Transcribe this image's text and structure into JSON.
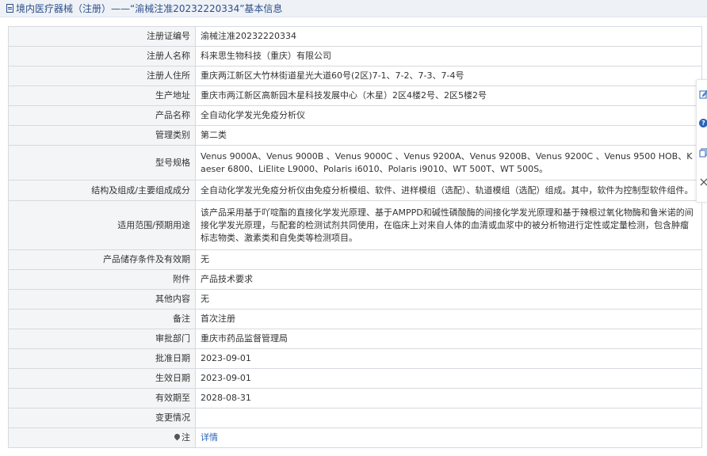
{
  "header": {
    "title": "境内医疗器械（注册）——“渝械注准20232220334”基本信息"
  },
  "rows": [
    {
      "label": "注册证编号",
      "value": "渝械注准20232220334"
    },
    {
      "label": "注册人名称",
      "value": "科来思生物科技（重庆）有限公司"
    },
    {
      "label": "注册人住所",
      "value": "重庆两江新区大竹林街道星光大道60号(2区)7-1、7-2、7-3、7-4号"
    },
    {
      "label": "生产地址",
      "value": "重庆市两江新区高新园木星科技发展中心（木星）2区4楼2号、2区5楼2号"
    },
    {
      "label": "产品名称",
      "value": "全自动化学发光免疫分析仪"
    },
    {
      "label": "管理类别",
      "value": "第二类"
    },
    {
      "label": "型号规格",
      "value": "Venus 9000A、Venus 9000B 、Venus 9000C 、Venus 9200A、Venus 9200B、Venus 9200C 、Venus 9500 HOB、Kaeser 6800、LiElite L9000、Polaris i6010、Polaris i9010、WT 500T、WT 500S。"
    },
    {
      "label": "结构及组成/主要组成成分",
      "value": "全自动化学发光免疫分析仪由免疫分析模组、软件、进样模组（选配）、轨道模组（选配）组成。其中，软件为控制型软件组件。"
    },
    {
      "label": "适用范围/预期用途",
      "value": "该产品采用基于吖啶酯的直接化学发光原理、基于AMPPD和碱性磷酸酶的间接化学发光原理和基于辣根过氧化物酶和鲁米诺的间接化学发光原理，与配套的检测试剂共同使用，在临床上对来自人体的血清或血浆中的被分析物进行定性或定量检测，包含肿瘤标志物类、激素类和自免类等检测项目。"
    },
    {
      "label": "产品储存条件及有效期",
      "value": "无"
    },
    {
      "label": "附件",
      "value": "产品技术要求"
    },
    {
      "label": "其他内容",
      "value": "无"
    },
    {
      "label": "备注",
      "value": "首次注册"
    },
    {
      "label": "审批部门",
      "value": "重庆市药品监督管理局"
    },
    {
      "label": "批准日期",
      "value": "2023-09-01"
    },
    {
      "label": "生效日期",
      "value": "2023-09-01"
    },
    {
      "label": "有效期至",
      "value": "2028-08-31"
    },
    {
      "label": "变更情况",
      "value": ""
    }
  ],
  "note": {
    "label": "注",
    "link_text": "详情"
  },
  "icons": {
    "header": "document-icon",
    "note": "pin-icon",
    "side": [
      "edit-icon",
      "help-icon",
      "copy-icon",
      "close-icon"
    ]
  }
}
